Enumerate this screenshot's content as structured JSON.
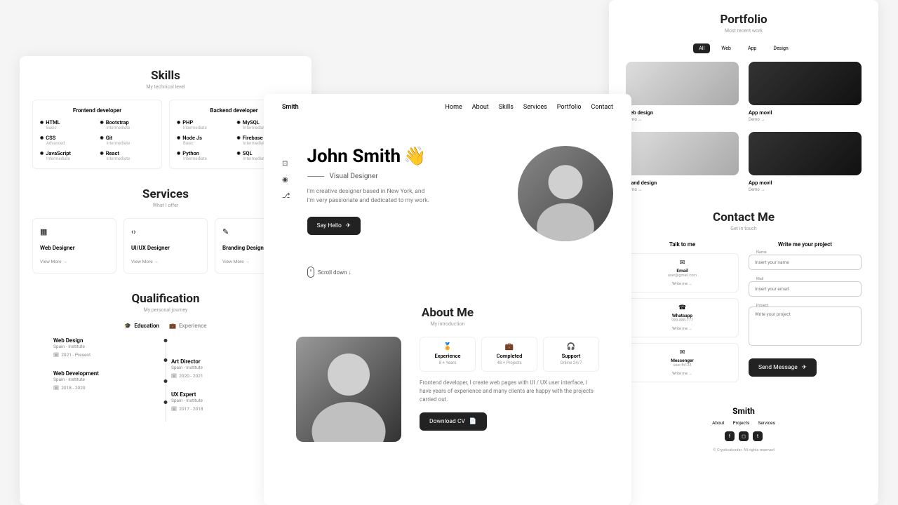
{
  "skills": {
    "title": "Skills",
    "subtitle": "My technical level",
    "cards": [
      {
        "title": "Frontend developer",
        "items": [
          {
            "name": "HTML",
            "level": "Basic"
          },
          {
            "name": "Bootstrap",
            "level": "Intermediate"
          },
          {
            "name": "CSS",
            "level": "Advanced"
          },
          {
            "name": "Git",
            "level": "Intermediate"
          },
          {
            "name": "JavaScript",
            "level": "Intermediate"
          },
          {
            "name": "React",
            "level": "Intermediate"
          }
        ]
      },
      {
        "title": "Backend developer",
        "items": [
          {
            "name": "PHP",
            "level": "Intermediate"
          },
          {
            "name": "MySQL",
            "level": "Intermediate"
          },
          {
            "name": "Node Js",
            "level": "Basic"
          },
          {
            "name": "Firebase",
            "level": "Intermediate"
          },
          {
            "name": "Python",
            "level": "Intermediate"
          },
          {
            "name": "SQL",
            "level": "Intermediate"
          }
        ]
      }
    ]
  },
  "services": {
    "title": "Services",
    "subtitle": "What I offer",
    "items": [
      {
        "name": "Web\nDesigner",
        "link": "View More →"
      },
      {
        "name": "UI/UX\nDesigner",
        "link": "View More →"
      },
      {
        "name": "Branding\nDesigner",
        "link": "View More →"
      }
    ]
  },
  "qualification": {
    "title": "Qualification",
    "subtitle": "My personal journey",
    "tabs": {
      "education": "Education",
      "experience": "Experience"
    },
    "left": [
      {
        "name": "Web Design",
        "place": "Spain - Institute",
        "date": "2021 - Present"
      },
      {
        "name": "Web Development",
        "place": "Spain - Institute",
        "date": "2018 - 2020"
      }
    ],
    "right": [
      {
        "name": "Art Director",
        "place": "Spain - Institute",
        "date": "2020 - 2021"
      },
      {
        "name": "UX Expert",
        "place": "Spain - Institute",
        "date": "2017 - 2018"
      }
    ]
  },
  "nav": {
    "logo": "Smith",
    "links": [
      "Home",
      "About",
      "Skills",
      "Services",
      "Portfolio",
      "Contact"
    ]
  },
  "hero": {
    "name": "John Smith",
    "wave": "👋",
    "role": "Visual Designer",
    "desc": "I'm creative designer based in New York, and I'm very passionate and dedicated to my work.",
    "button": "Say Hello",
    "scroll": "Scroll down ↓"
  },
  "about": {
    "title": "About Me",
    "subtitle": "My introduction",
    "stats": [
      {
        "name": "Experience",
        "value": "8 + Years"
      },
      {
        "name": "Completed",
        "value": "48 + Projects"
      },
      {
        "name": "Support",
        "value": "Online 24/7"
      }
    ],
    "desc": "Frontend developer, I create web pages with UI / UX user interface, I have years of experience and many clients are happy with the projects carried out.",
    "button": "Download CV"
  },
  "portfolio": {
    "title": "Portfolio",
    "subtitle": "Most recent work",
    "filters": [
      "All",
      "Web",
      "App",
      "Design"
    ],
    "items": [
      {
        "title": "Web design",
        "link": "Demo →",
        "dark": false
      },
      {
        "title": "App movil",
        "link": "Demo →",
        "dark": true
      },
      {
        "title": "Brand design",
        "link": "Demo →",
        "dark": false
      },
      {
        "title": "App movil",
        "link": "Demo →",
        "dark": true
      }
    ]
  },
  "contact": {
    "title": "Contact Me",
    "subtitle": "Get in touch",
    "talk": "Talk to me",
    "write": "Write me your project",
    "cards": [
      {
        "name": "Email",
        "value": "user@gmail.com",
        "link": "Write me →"
      },
      {
        "name": "Whatsapp",
        "value": "999-888-777",
        "link": "Write me →"
      },
      {
        "name": "Messenger",
        "value": "user.fb123",
        "link": "Write me →"
      }
    ],
    "form": {
      "name_label": "Name",
      "name_ph": "Insert your name",
      "mail_label": "Mail",
      "mail_ph": "Insert your email",
      "project_label": "Project",
      "project_ph": "Write your project",
      "button": "Send Message"
    }
  },
  "footer": {
    "title": "Smith",
    "links": [
      "About",
      "Projects",
      "Services"
    ],
    "copyright": "© Crypticalcoder. All rights reserved"
  }
}
